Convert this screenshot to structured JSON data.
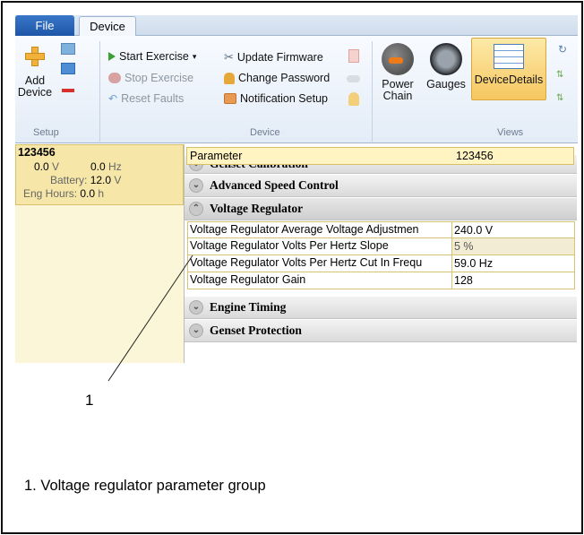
{
  "tabs": {
    "file": "File",
    "device": "Device"
  },
  "ribbon": {
    "setup": {
      "add_device": "Add\nDevice",
      "label": "Setup"
    },
    "device": {
      "start_exercise": "Start Exercise",
      "stop_exercise": "Stop Exercise",
      "reset_faults": "Reset Faults",
      "update_firmware": "Update Firmware",
      "change_password": "Change Password",
      "notification_setup": "Notification Setup",
      "label": "Device"
    },
    "views": {
      "power_chain_line1": "Power",
      "power_chain_line2": "Chain",
      "gauges": "Gauges",
      "device_details": "DeviceDetails",
      "label": "Views"
    }
  },
  "device_card": {
    "id": "123456",
    "voltage": "0.0",
    "voltage_unit": "V",
    "frequency": "0.0",
    "frequency_unit": "Hz",
    "battery_label": "Battery:",
    "battery": "12.0",
    "battery_unit": "V",
    "eng_hours_label": "Eng Hours:",
    "eng_hours": "0.0",
    "eng_hours_unit": "h"
  },
  "grid": {
    "col_parameter": "Parameter",
    "col_value": "123456",
    "groups": {
      "genset_calibration": "Genset Calibration",
      "advanced_speed_control": "Advanced Speed Control",
      "voltage_regulator": "Voltage Regulator",
      "engine_timing": "Engine Timing",
      "genset_protection": "Genset Protection"
    },
    "rows": [
      {
        "name": "Voltage Regulator Average Voltage Adjustmen",
        "value": "240.0 V"
      },
      {
        "name": "Voltage Regulator Volts Per Hertz Slope",
        "value": "5 %"
      },
      {
        "name": "Voltage Regulator Volts Per Hertz Cut In Frequ",
        "value": "59.0 Hz"
      },
      {
        "name": "Voltage Regulator Gain",
        "value": "128"
      }
    ]
  },
  "callout": {
    "number": "1"
  },
  "caption": "1. Voltage regulator parameter group"
}
